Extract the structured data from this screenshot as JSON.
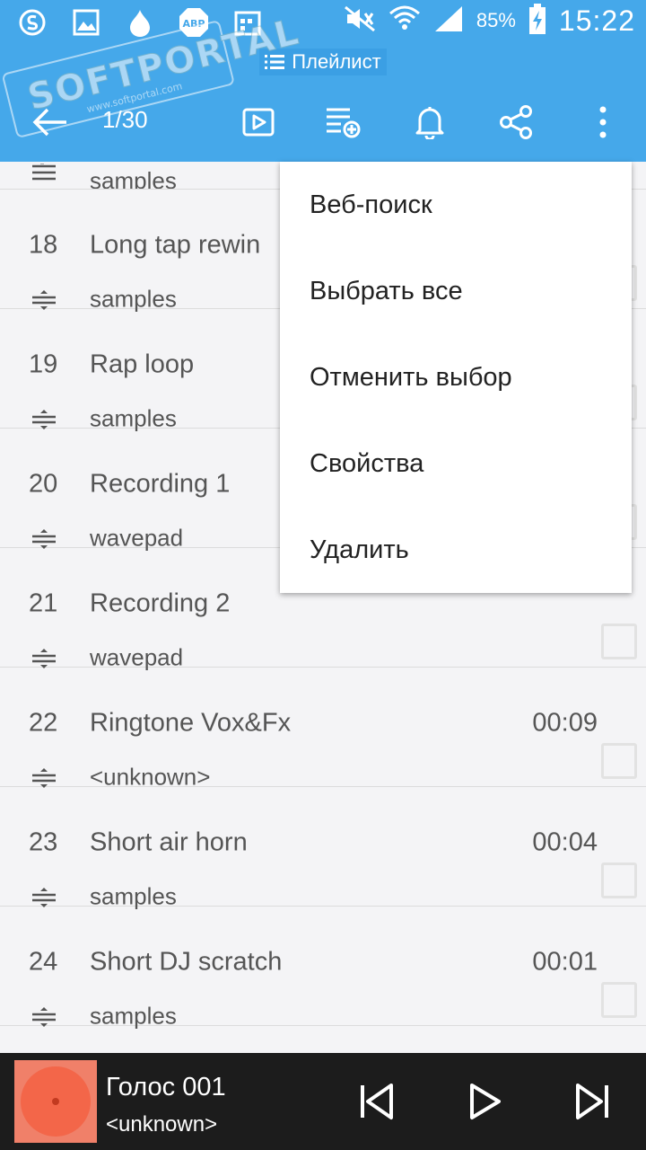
{
  "status_bar": {
    "battery": "85%",
    "time": "15:22",
    "icons": [
      "s-app-icon",
      "gallery-icon",
      "drop-icon",
      "adblock-icon",
      "calendar-icon",
      "mute-icon",
      "wifi-icon",
      "signal-icon",
      "battery-charging-icon"
    ]
  },
  "header": {
    "title": "Плейлист",
    "counter": "1/30",
    "watermark": "SOFTPORTAL",
    "watermark_url": "www.softportal.com",
    "icons": [
      "back-arrow-icon",
      "play-box-icon",
      "add-to-playlist-icon",
      "bell-icon",
      "share-icon",
      "more-vert-icon"
    ]
  },
  "partial_row": {
    "artist": "samples"
  },
  "tracks": [
    {
      "num": "18",
      "title": "Long tap rewin",
      "artist": "samples",
      "duration": ""
    },
    {
      "num": "19",
      "title": "Rap loop",
      "artist": "samples",
      "duration": ""
    },
    {
      "num": "20",
      "title": "Recording 1",
      "artist": "wavepad",
      "duration": ""
    },
    {
      "num": "21",
      "title": "Recording 2",
      "artist": "wavepad",
      "duration": ""
    },
    {
      "num": "22",
      "title": "Ringtone Vox&Fx",
      "artist": "<unknown>",
      "duration": "00:09"
    },
    {
      "num": "23",
      "title": "Short air horn",
      "artist": "samples",
      "duration": "00:04"
    },
    {
      "num": "24",
      "title": "Short DJ scratch",
      "artist": "samples",
      "duration": "00:01"
    }
  ],
  "menu": {
    "items": [
      "Веб-поиск",
      "Выбрать все",
      "Отменить выбор",
      "Свойства",
      "Удалить"
    ]
  },
  "player": {
    "title": "Голос 001",
    "artist": "<unknown>"
  },
  "colors": {
    "accent": "#45a8ea",
    "player_bg": "#1c1c1c",
    "cover": "#f36649"
  }
}
